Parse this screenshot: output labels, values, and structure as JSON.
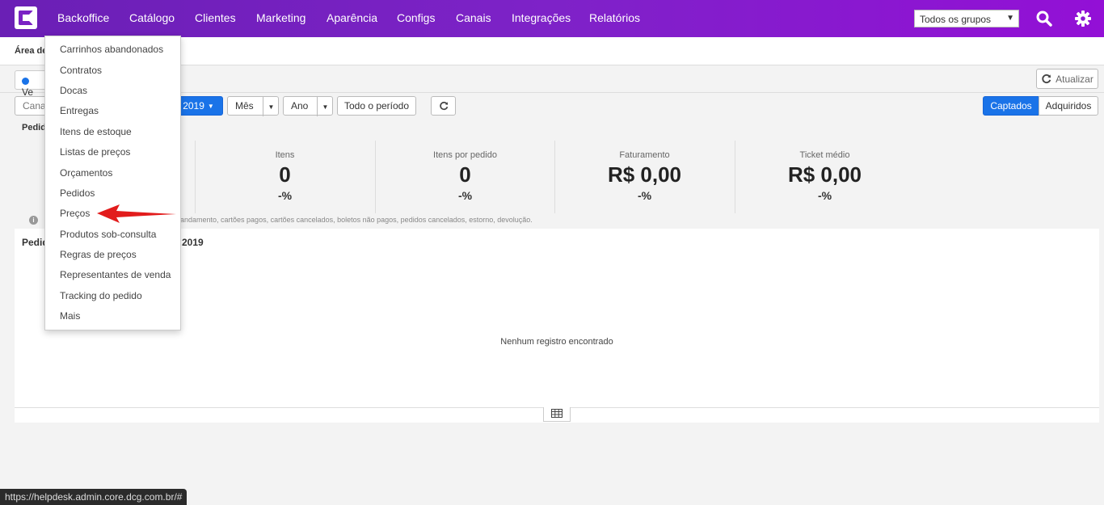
{
  "nav": {
    "items": [
      "Backoffice",
      "Catálogo",
      "Clientes",
      "Marketing",
      "Aparência",
      "Configs",
      "Canais",
      "Integrações",
      "Relatórios"
    ],
    "group_select": "Todos os grupos"
  },
  "subheader": {
    "title": "Área de"
  },
  "toolbar": {
    "chip_label": "Ve",
    "refresh_label": "Atualizar",
    "channel_label": "Canal",
    "year_button": "2019",
    "month_button": "Mês",
    "year2_button": "Ano",
    "all_period_button": "Todo o período",
    "captured_button": "Captados",
    "acquired_button": "Adquiridos"
  },
  "panel": {
    "title": "Pedid"
  },
  "stats": [
    {
      "label": "Itens",
      "value": "0",
      "pct": "-%"
    },
    {
      "label": "Itens por pedido",
      "value": "0",
      "pct": "-%"
    },
    {
      "label": "Faturamento",
      "value": "R$ 0,00",
      "pct": "-%"
    },
    {
      "label": "Ticket médio",
      "value": "R$ 0,00",
      "pct": "-%"
    }
  ],
  "note": "andamento, cartões pagos, cartões cancelados, boletos não pagos, pedidos cancelados, estorno, devolução.",
  "grid": {
    "title": "Pedid",
    "title_year": "2019",
    "empty": "Nenhum registro encontrado"
  },
  "dropdown": {
    "items": [
      "Carrinhos abandonados",
      "Contratos",
      "Docas",
      "Entregas",
      "Itens de estoque",
      "Listas de preços",
      "Orçamentos",
      "Pedidos",
      "Preços",
      "Produtos sob-consulta",
      "Regras de preços",
      "Representantes de venda",
      "Tracking do pedido",
      "Mais"
    ]
  },
  "status_url": "https://helpdesk.admin.core.dcg.com.br/#",
  "colors": {
    "accent": "#1a73e8",
    "topbar_start": "#6a1fb5",
    "topbar_end": "#9310d6",
    "arrow": "#e21c1c"
  }
}
